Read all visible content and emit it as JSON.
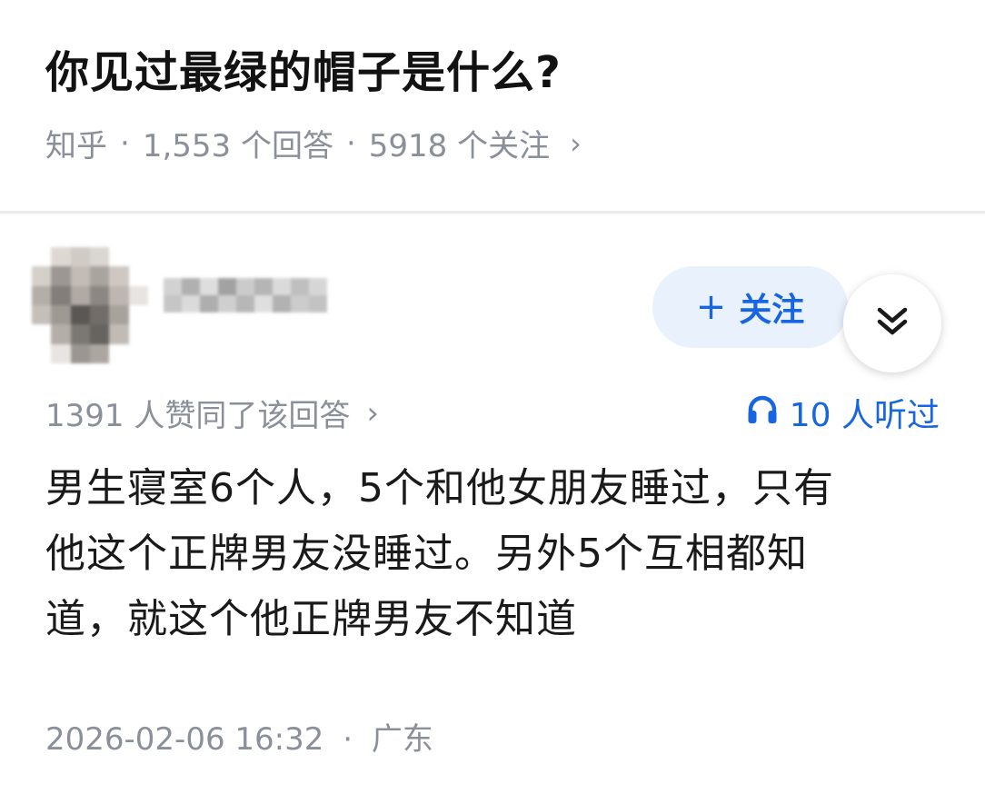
{
  "question": {
    "title": "你见过最绿的帽子是什么?",
    "source": "知乎",
    "answer_count": "1,553 个回答",
    "follower_count": "5918 个关注",
    "separator": "·",
    "chevron": "›"
  },
  "author": {
    "avatar_icon": "blurred-avatar",
    "name_hidden": true,
    "follow_label": "关注",
    "follow_icon": "+",
    "expand_icon": "double-chevron-down-icon"
  },
  "answer": {
    "vote_text": "1391 人赞同了该回答",
    "listen_icon": "headphones-icon",
    "listen_text": "10 人听过",
    "body_lines": [
      "男生寝室6个人，5个和他女朋友睡过，只有",
      "他这个正牌男友没睡过。另外5个互相都知",
      "道，就这个他正牌男友不知道"
    ],
    "datetime": "2026-02-06 16:32",
    "location": "广东"
  },
  "colors": {
    "accent": "#1765e0",
    "follow_bg": "#e9f1fc",
    "muted_text": "#8a8f99",
    "divider": "#ebebeb"
  }
}
